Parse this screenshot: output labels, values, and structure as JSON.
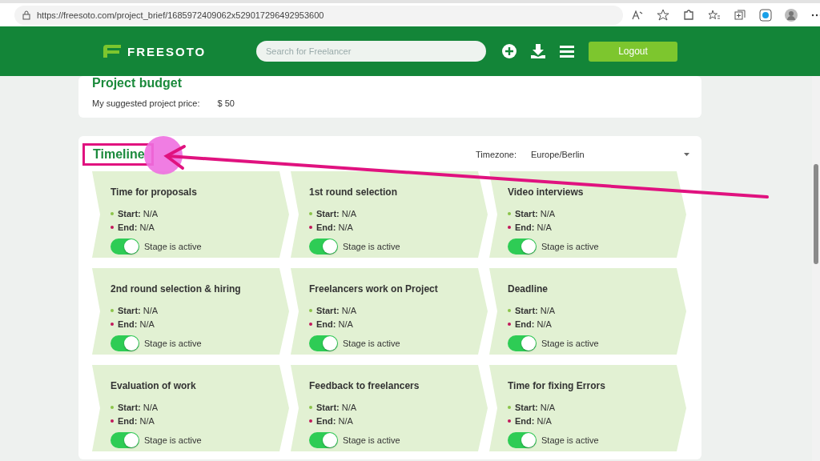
{
  "browser": {
    "url": "https://freesoto.com/project_brief/1685972409062x529017296492953600"
  },
  "header": {
    "logo": "FREESOTO",
    "search": {
      "placeholder": "Search for Freelancer"
    },
    "logout": "Logout"
  },
  "budget": {
    "title": "Project budget",
    "label": "My suggested project price:",
    "value": "$ 50"
  },
  "timeline": {
    "title": "Timeline",
    "highlighted": true,
    "timezone_label": "Timezone:",
    "timezone": "Europe/Berlin",
    "stages": [
      {
        "title": "Time for proposals",
        "start_label": "Start:",
        "start": "N/A",
        "end_label": "End:",
        "end": "N/A",
        "toggle_label": "Stage is active",
        "on": true
      },
      {
        "title": "1st round selection",
        "start_label": "Start:",
        "start": "N/A",
        "end_label": "End:",
        "end": "N/A",
        "toggle_label": "Stage is active",
        "on": true
      },
      {
        "title": "Video interviews",
        "start_label": "Start:",
        "start": "N/A",
        "end_label": "End:",
        "end": "N/A",
        "toggle_label": "Stage is active",
        "on": true
      },
      {
        "title": "2nd round selection & hiring",
        "start_label": "Start:",
        "start": "N/A",
        "end_label": "End:",
        "end": "N/A",
        "toggle_label": "Stage is active",
        "on": true
      },
      {
        "title": "Freelancers work on Project",
        "start_label": "Start:",
        "start": "N/A",
        "end_label": "End:",
        "end": "N/A",
        "toggle_label": "Stage is active",
        "on": true
      },
      {
        "title": "Deadline",
        "start_label": "Start:",
        "start": "N/A",
        "end_label": "End:",
        "end": "N/A",
        "toggle_label": "Stage is active",
        "on": true
      },
      {
        "title": "Evaluation of work",
        "start_label": "Start:",
        "start": "N/A",
        "end_label": "End:",
        "end": "N/A",
        "toggle_label": "Stage is active",
        "on": true
      },
      {
        "title": "Feedback to freelancers",
        "start_label": "Start:",
        "start": "N/A",
        "end_label": "End:",
        "end": "N/A",
        "toggle_label": "Stage is active",
        "on": true
      },
      {
        "title": "Time for fixing Errors",
        "start_label": "Start:",
        "start": "N/A",
        "end_label": "End:",
        "end": "N/A",
        "toggle_label": "Stage is active",
        "on": true
      }
    ]
  }
}
